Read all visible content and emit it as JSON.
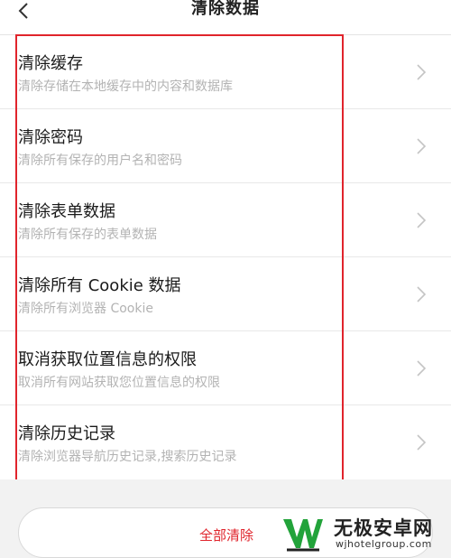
{
  "header": {
    "title": "清除数据",
    "back_icon": "chevron-left-icon"
  },
  "items": [
    {
      "title": "清除缓存",
      "subtitle": "清除存储在本地缓存中的内容和数据库"
    },
    {
      "title": "清除密码",
      "subtitle": "清除所有保存的用户名和密码"
    },
    {
      "title": "清除表单数据",
      "subtitle": "清除所有保存的表单数据"
    },
    {
      "title": "清除所有 Cookie 数据",
      "subtitle": "清除所有浏览器 Cookie"
    },
    {
      "title": "取消获取位置信息的权限",
      "subtitle": "取消所有网站获取您位置信息的权限"
    },
    {
      "title": "清除历史记录",
      "subtitle": "清除浏览器导航历史记录,搜索历史记录"
    }
  ],
  "actions": {
    "clear_all_label": "全部清除"
  },
  "watermark": {
    "name": "无极安卓网",
    "url": "wjhotelgroup.com"
  },
  "colors": {
    "accent_red": "#e0242c",
    "watermark_green": "#22a33a"
  }
}
